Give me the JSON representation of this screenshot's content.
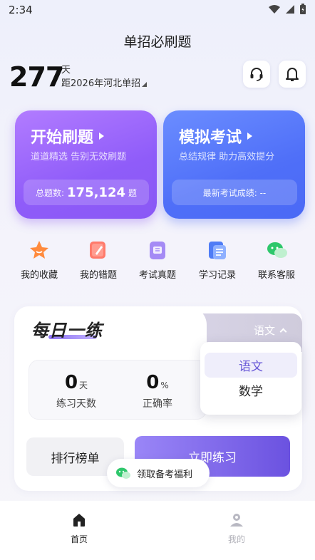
{
  "status_bar": {
    "time": "2:34"
  },
  "header": {
    "title": "单招必刷题"
  },
  "countdown": {
    "days": "277",
    "unit": "天",
    "target": "距2026年河北单招"
  },
  "cards": {
    "practice": {
      "title": "开始刷题",
      "subtitle": "道道精选 告别无效刷题",
      "stat_label": "总题数:",
      "stat_value": "175,124",
      "stat_unit": "题"
    },
    "exam": {
      "title": "模拟考试",
      "subtitle": "总结规律 助力高效提分",
      "stat_text": "最新考试成绩: --"
    }
  },
  "shortcuts": [
    {
      "label": "我的收藏",
      "icon": "star-icon"
    },
    {
      "label": "我的错题",
      "icon": "wrong-book-icon"
    },
    {
      "label": "考试真题",
      "icon": "exam-paper-icon"
    },
    {
      "label": "学习记录",
      "icon": "record-icon"
    },
    {
      "label": "联系客服",
      "icon": "wechat-icon"
    }
  ],
  "daily": {
    "title": "每日一练",
    "selected_subject": "语文",
    "stats": [
      {
        "value": "0",
        "unit": "天",
        "label": "练习天数"
      },
      {
        "value": "0",
        "unit": "%",
        "label": "正确率"
      }
    ],
    "subject_options": [
      "语文",
      "数学"
    ],
    "rank_button": "排行榜单",
    "start_button": "立即练习",
    "welfare": "领取备考福利"
  },
  "bottom_nav": [
    {
      "label": "首页",
      "active": true
    },
    {
      "label": "我的",
      "active": false
    }
  ],
  "colors": {
    "accent_purple": "#8f5cf9",
    "accent_blue": "#4f6ff8",
    "nav_active": "#222222",
    "nav_inactive": "#b0b0b8"
  }
}
